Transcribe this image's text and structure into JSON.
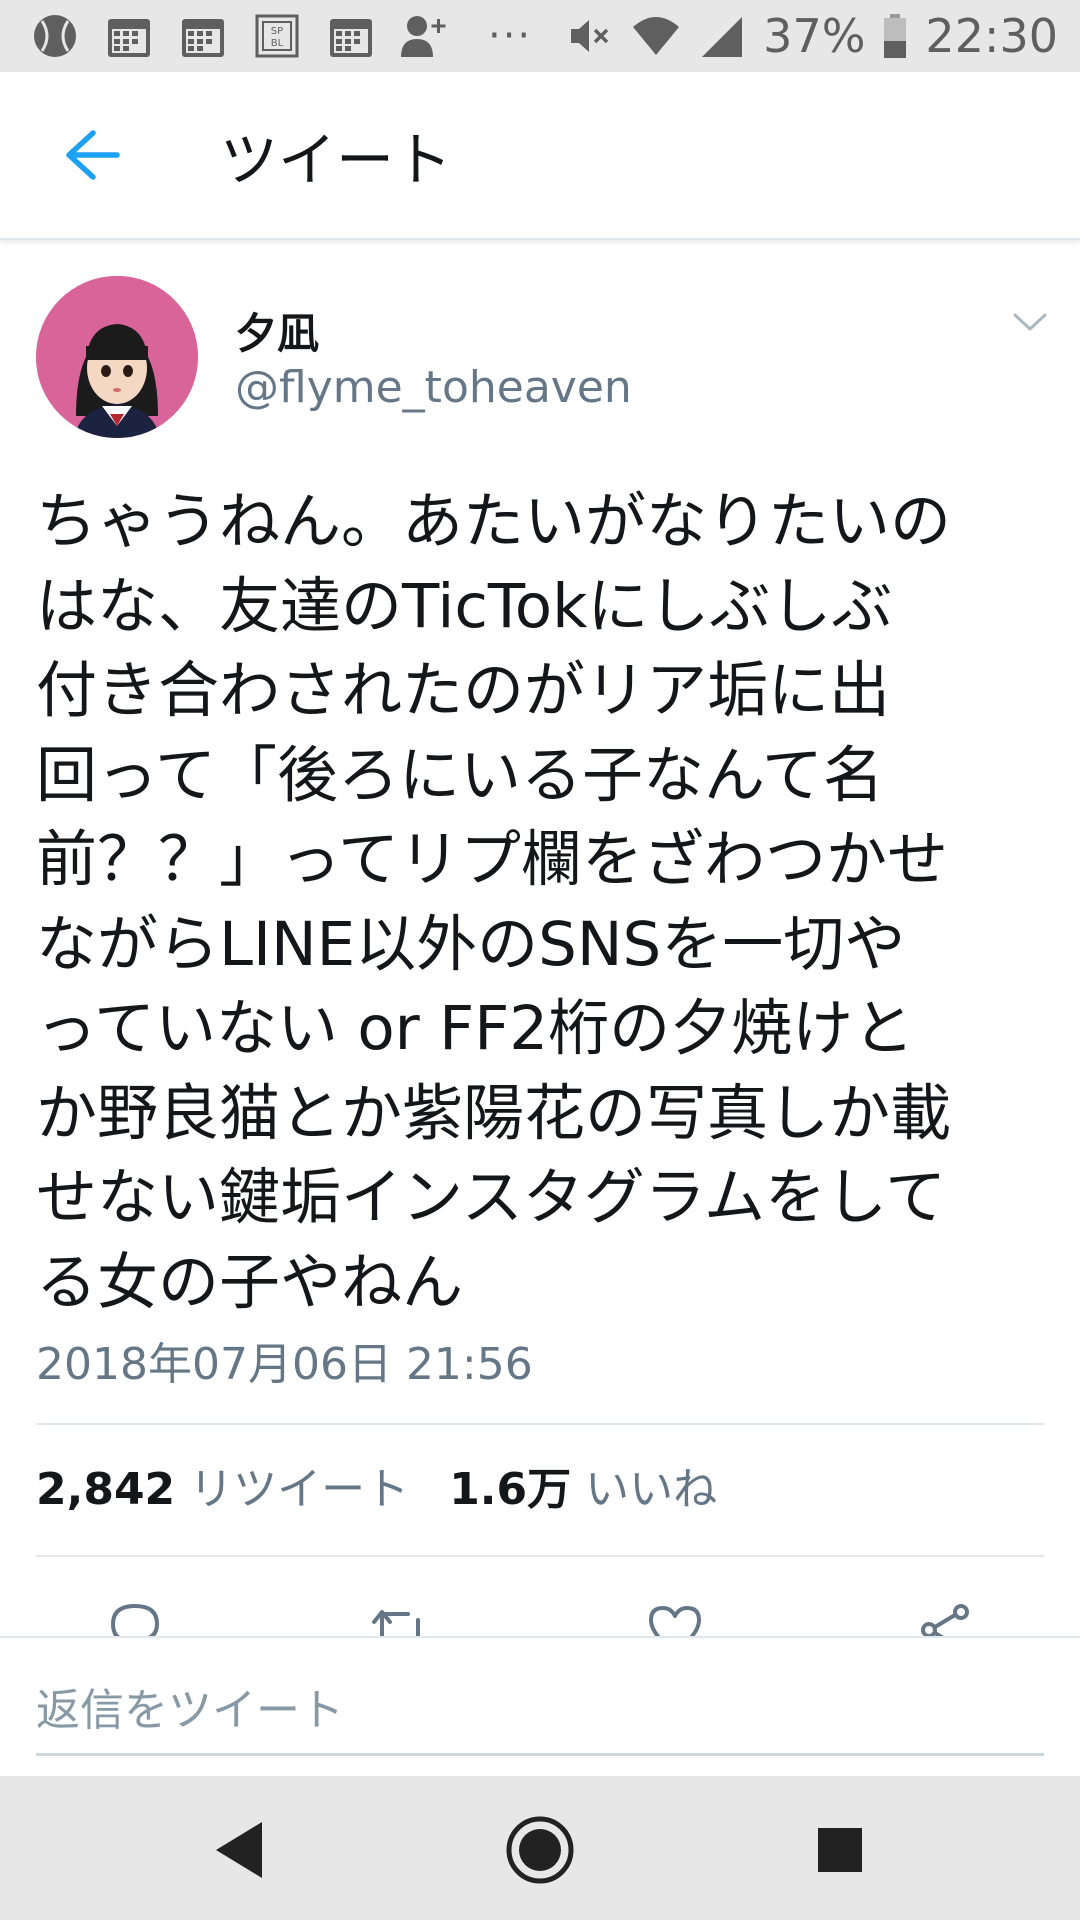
{
  "status_bar": {
    "battery": "37%",
    "time": "22:30",
    "dots": "···",
    "icons": [
      "baseball-icon",
      "calendar-icon",
      "calendar-icon",
      "sp-bl-app-icon",
      "calendar-icon",
      "add-person-icon",
      "mute-icon",
      "wifi-icon",
      "signal-icon",
      "battery-icon"
    ]
  },
  "header": {
    "title": "ツイート",
    "back_icon": "back-arrow-icon"
  },
  "tweet": {
    "display_name": "夕凪",
    "handle": "@flyme_toheaven",
    "text_lines": [
      "ちゃうねん。あたいがなりたいの",
      "はな、友達のTicTokにしぶしぶ",
      "付き合わされたのがリア垢に出",
      "回って「後ろにいる子なんて名",
      "前？？」ってリプ欄をざわつかせ",
      "ながらLINE以外のSNSを一切や",
      "っていない or FF2桁の夕焼けと",
      "か野良猫とか紫陽花の写真しか載",
      "せない鍵垢インスタグラムをして",
      "る女の子やねん"
    ],
    "timestamp": "2018年07月06日 21:56",
    "retweet_count": "2,842",
    "retweet_label": "リツイート",
    "like_count": "1.6万",
    "like_label": "いいね",
    "actions": [
      "reply-icon",
      "retweet-icon",
      "like-icon",
      "share-icon"
    ]
  },
  "reply": {
    "placeholder": "返信をツイート"
  },
  "nav": {
    "buttons": [
      "back-triangle-icon",
      "home-circle-icon",
      "recents-square-icon"
    ]
  },
  "colors": {
    "accent": "#1da1f2",
    "text": "#14171a",
    "secondary": "#657786",
    "avatar_bg": "#d9649a"
  }
}
